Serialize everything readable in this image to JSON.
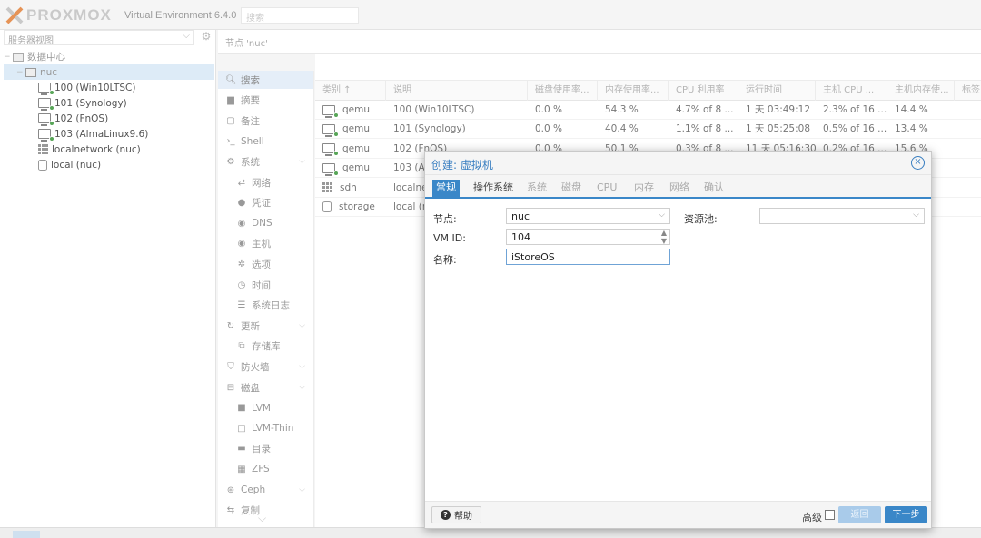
{
  "header": {
    "logo_text": "PROXMOX",
    "version": "Virtual Environment 6.4.0",
    "search_placeholder": "搜索"
  },
  "tree": {
    "view_label": "服务器视图",
    "root": "数据中心",
    "node": "nuc",
    "items": [
      {
        "label": "100 (Win10LTSC)",
        "icon": "vm-running-icon"
      },
      {
        "label": "101 (Synology)",
        "icon": "vm-running-icon"
      },
      {
        "label": "102 (FnOS)",
        "icon": "vm-running-icon"
      },
      {
        "label": "103 (AlmaLinux9.6)",
        "icon": "vm-running-icon"
      },
      {
        "label": "localnetwork (nuc)",
        "icon": "network-grid-icon"
      },
      {
        "label": "local (nuc)",
        "icon": "storage-icon"
      }
    ]
  },
  "content": {
    "title": "节点 'nuc'"
  },
  "nav": {
    "items": [
      {
        "label": "搜索",
        "icon": "search-icon",
        "indent": false,
        "active": true
      },
      {
        "label": "摘要",
        "icon": "book-icon",
        "indent": false
      },
      {
        "label": "备注",
        "icon": "note-icon",
        "indent": false
      },
      {
        "label": "Shell",
        "icon": "terminal-icon",
        "indent": false
      },
      {
        "label": "系统",
        "icon": "cogs-icon",
        "indent": false,
        "chevron": true
      },
      {
        "label": "网络",
        "icon": "exchange-icon",
        "indent": true
      },
      {
        "label": "凭证",
        "icon": "certificate-icon",
        "indent": true
      },
      {
        "label": "DNS",
        "icon": "globe-icon",
        "indent": true
      },
      {
        "label": "主机",
        "icon": "globe-icon",
        "indent": true
      },
      {
        "label": "选项",
        "icon": "gear-icon",
        "indent": true
      },
      {
        "label": "时间",
        "icon": "clock-icon",
        "indent": true
      },
      {
        "label": "系统日志",
        "icon": "list-icon",
        "indent": true
      },
      {
        "label": "更新",
        "icon": "refresh-icon",
        "indent": false,
        "chevron": true
      },
      {
        "label": "存储库",
        "icon": "files-icon",
        "indent": true
      },
      {
        "label": "防火墙",
        "icon": "shield-icon",
        "indent": false,
        "chevron": true
      },
      {
        "label": "磁盘",
        "icon": "hdd-icon",
        "indent": false,
        "chevron": true
      },
      {
        "label": "LVM",
        "icon": "square-icon",
        "indent": true
      },
      {
        "label": "LVM-Thin",
        "icon": "square-outline-icon",
        "indent": true
      },
      {
        "label": "目录",
        "icon": "folder-icon",
        "indent": true
      },
      {
        "label": "ZFS",
        "icon": "grid-icon",
        "indent": true
      },
      {
        "label": "Ceph",
        "icon": "ceph-icon",
        "indent": false,
        "chevron": true
      },
      {
        "label": "复制",
        "icon": "retweet-icon",
        "indent": false
      }
    ]
  },
  "grid": {
    "columns": [
      "类别 ↑",
      "说明",
      "磁盘使用率...",
      "内存使用率...",
      "CPU 利用率",
      "运行时间",
      "主机 CPU ...",
      "主机内存使...",
      "标签"
    ],
    "rows": [
      {
        "type": "qemu",
        "desc": "100 (Win10LTSC)",
        "disk": "0.0 %",
        "mem": "54.3 %",
        "cpu": "4.7% of 8 ...",
        "uptime": "1 天 03:49:12",
        "hcpu": "2.3% of 16 ...",
        "hmem": "14.4 %",
        "icon": "vm-running-icon"
      },
      {
        "type": "qemu",
        "desc": "101 (Synology)",
        "disk": "0.0 %",
        "mem": "40.4 %",
        "cpu": "1.1% of 8 ...",
        "uptime": "1 天 05:25:08",
        "hcpu": "0.5% of 16 ...",
        "hmem": "13.4 %",
        "icon": "vm-running-icon"
      },
      {
        "type": "qemu",
        "desc": "102 (FnOS)",
        "disk": "0.0 %",
        "mem": "50.1 %",
        "cpu": "0.3% of 8 ...",
        "uptime": "11 天 05:16:30",
        "hcpu": "0.2% of 16 ...",
        "hmem": "15.6 %",
        "icon": "vm-running-icon"
      },
      {
        "type": "qemu",
        "desc": "103 (Al",
        "disk": "",
        "mem": "",
        "cpu": "",
        "uptime": "",
        "hcpu": "",
        "hmem": "",
        "icon": "vm-running-icon"
      },
      {
        "type": "sdn",
        "desc": "localne",
        "disk": "",
        "mem": "",
        "cpu": "",
        "uptime": "",
        "hcpu": "",
        "hmem": "",
        "icon": "network-grid-icon"
      },
      {
        "type": "storage",
        "desc": "local (n",
        "disk": "",
        "mem": "",
        "cpu": "",
        "uptime": "",
        "hcpu": "",
        "hmem": "",
        "icon": "storage-icon"
      }
    ]
  },
  "dialog": {
    "title": "创建: 虚拟机",
    "tabs": [
      {
        "label": "常规",
        "state": "active"
      },
      {
        "label": "操作系统",
        "state": "enabled"
      },
      {
        "label": "系统",
        "state": "disabled"
      },
      {
        "label": "磁盘",
        "state": "disabled"
      },
      {
        "label": "CPU",
        "state": "disabled"
      },
      {
        "label": "内存",
        "state": "disabled"
      },
      {
        "label": "网络",
        "state": "disabled"
      },
      {
        "label": "确认",
        "state": "disabled"
      }
    ],
    "node_label": "节点:",
    "node_value": "nuc",
    "pool_label": "资源池:",
    "pool_value": "",
    "vmid_label": "VM ID:",
    "vmid_value": "104",
    "name_label": "名称:",
    "name_value": "iStoreOS",
    "help_label": "帮助",
    "advanced_label": "高级",
    "advanced_checked": false,
    "back_label": "返回",
    "next_label": "下一步"
  },
  "colors": {
    "accent": "#3a87c8",
    "running": "#57a557"
  }
}
